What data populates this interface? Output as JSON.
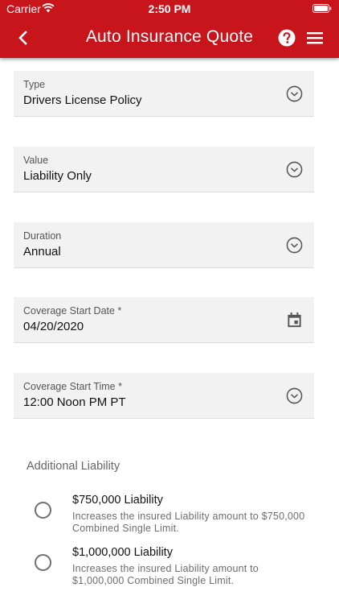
{
  "status_bar": {
    "carrier": "Carrier",
    "time": "2:50 PM"
  },
  "app_bar": {
    "title": "Auto Insurance Quote",
    "background_color": "#c8141b"
  },
  "fields": [
    {
      "label": "Type",
      "value": "Drivers License Policy",
      "icon": "chevron-down-circle-icon"
    },
    {
      "label": "Value",
      "value": "Liability Only",
      "icon": "chevron-down-circle-icon"
    },
    {
      "label": "Duration",
      "value": "Annual",
      "icon": "chevron-down-circle-icon"
    },
    {
      "label": "Coverage Start Date *",
      "value": "04/20/2020",
      "icon": "calendar-icon"
    },
    {
      "label": "Coverage Start Time *",
      "value": "12:00 Noon PM PT",
      "icon": "chevron-down-circle-icon"
    }
  ],
  "additional_liability": {
    "title": "Additional Liability",
    "options": [
      {
        "title": "$750,000 Liability",
        "description": "Increases the insured Liability amount to $750,000 Combined Single Limit.",
        "selected": false
      },
      {
        "title": "$1,000,000 Liability",
        "description": "Increases the insured Liability amount to $1,000,000 Combined Single Limit.",
        "selected": false
      }
    ]
  }
}
